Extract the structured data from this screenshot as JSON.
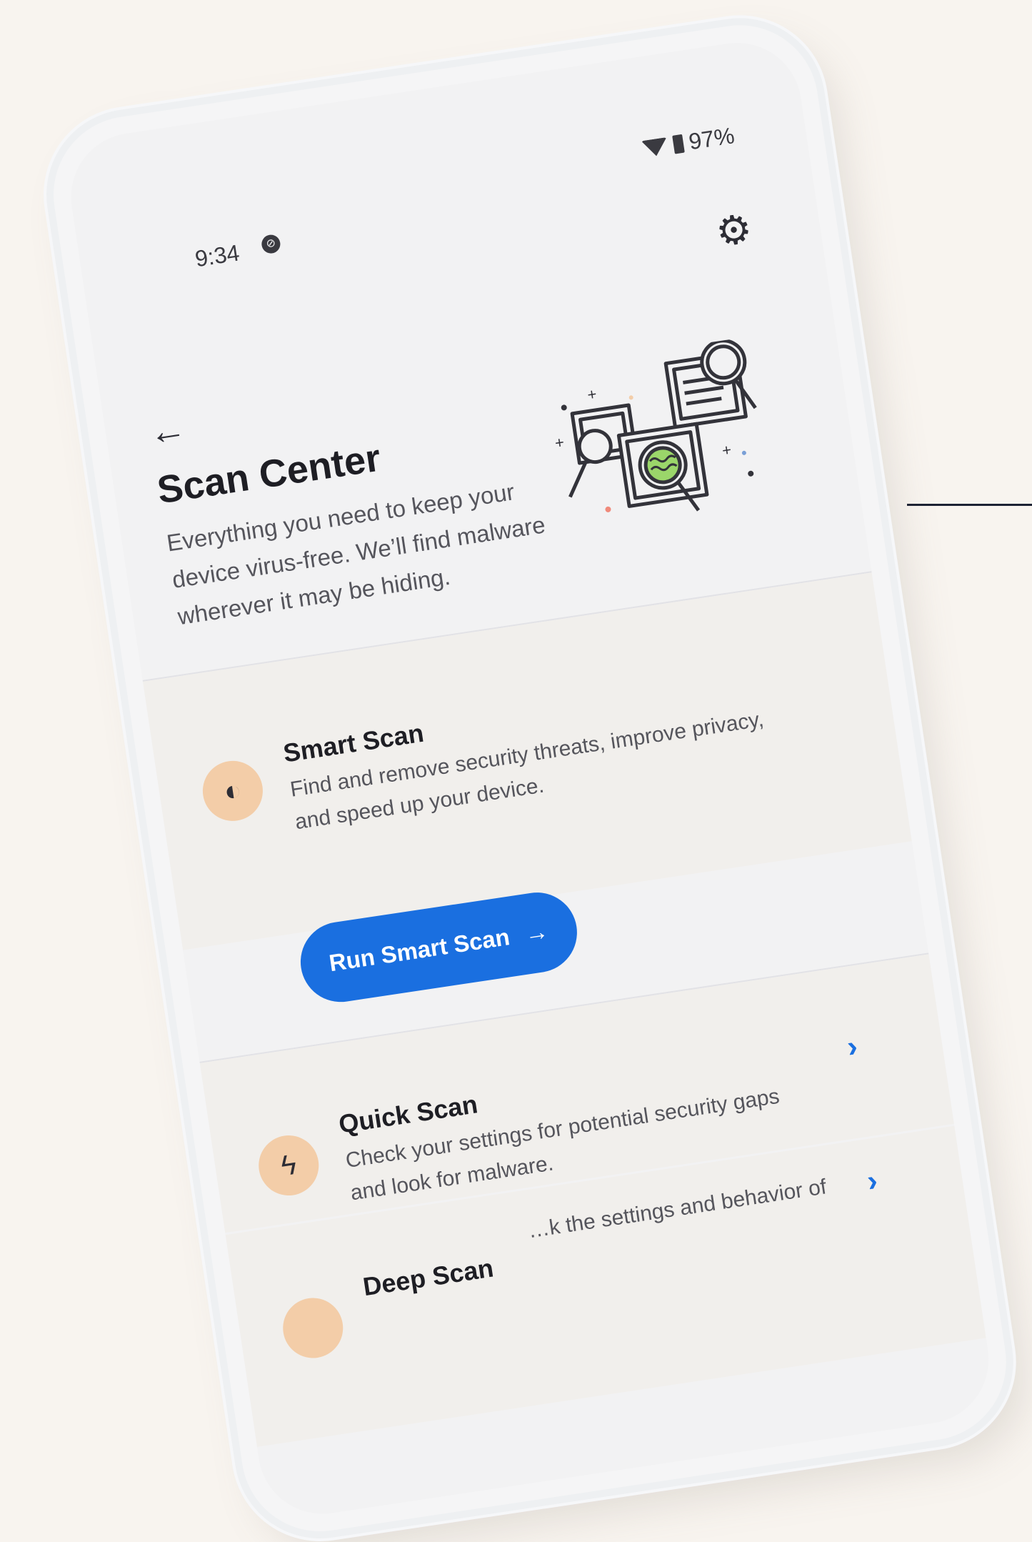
{
  "status_bar": {
    "time": "9:34",
    "battery": "97%"
  },
  "header": {
    "title": "Scan Center",
    "description": "Everything you need to keep your device virus-free. We’ll find malware wherever it may be hiding."
  },
  "smart_scan": {
    "title": "Smart Scan",
    "description": "Find and remove security threats, improve privacy, and speed up your device.",
    "button_label": "Run Smart Scan",
    "button_arrow": "→"
  },
  "quick_scan": {
    "title": "Quick Scan",
    "description": "Check your settings for potential security gaps and look for malware."
  },
  "deep_scan": {
    "title": "Deep Scan",
    "description": "…k the settings and behavior of"
  },
  "colors": {
    "accent": "#1a6fe0",
    "icon_bg": "#f3cda8",
    "background": "#f8f4ef"
  },
  "icons": {
    "back": "arrow-left-icon",
    "settings": "gear-icon",
    "smart_scan": "brain-icon",
    "quick_scan": "lightning-icon",
    "chevron": "chevron-right-icon"
  }
}
